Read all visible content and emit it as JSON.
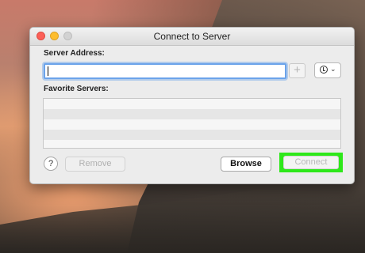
{
  "window": {
    "title": "Connect to Server",
    "traffic_lights": {
      "close_color": "#fc5f57",
      "minimize_color": "#fdbd2e",
      "zoom_color": "#d2d2d2"
    }
  },
  "server_address": {
    "label": "Server Address:",
    "value": "",
    "add_icon": "plus-icon",
    "history_icon": "clock-icon",
    "history_chevron": "chevron-down-icon"
  },
  "favorites": {
    "label": "Favorite Servers:",
    "items": []
  },
  "footer": {
    "help_label": "?",
    "remove_label": "Remove",
    "browse_label": "Browse",
    "connect_label": "Connect",
    "highlight_color": "#2ee81a"
  },
  "glyphs": {
    "plus": "+",
    "chevron": "⌄"
  }
}
